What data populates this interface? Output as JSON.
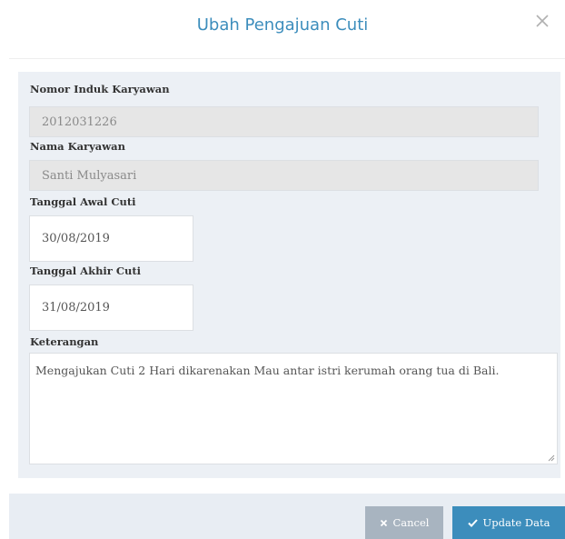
{
  "modal": {
    "title": "Ubah Pengajuan Cuti",
    "close_icon": "close-icon"
  },
  "form": {
    "employee_id": {
      "label": "Nomor Induk Karyawan",
      "value": "2012031226"
    },
    "employee_name": {
      "label": "Nama Karyawan",
      "value": "Santi Mulyasari"
    },
    "start_date": {
      "label": "Tanggal Awal Cuti",
      "value": "30/08/2019"
    },
    "end_date": {
      "label": "Tanggal Akhir Cuti",
      "value": "31/08/2019"
    },
    "notes": {
      "label": "Keterangan",
      "value": "Mengajukan Cuti 2 Hari dikarenakan Mau antar istri kerumah orang tua di Bali."
    }
  },
  "footer": {
    "cancel_label": "Cancel",
    "cancel_icon": "times-icon",
    "update_label": "Update Data",
    "update_icon": "check-icon"
  },
  "colors": {
    "accent": "#3c8dbc",
    "panel_bg": "#ecf0f5",
    "cancel_bg": "#a8b4c0",
    "readonly_bg": "#e6e6e6"
  }
}
